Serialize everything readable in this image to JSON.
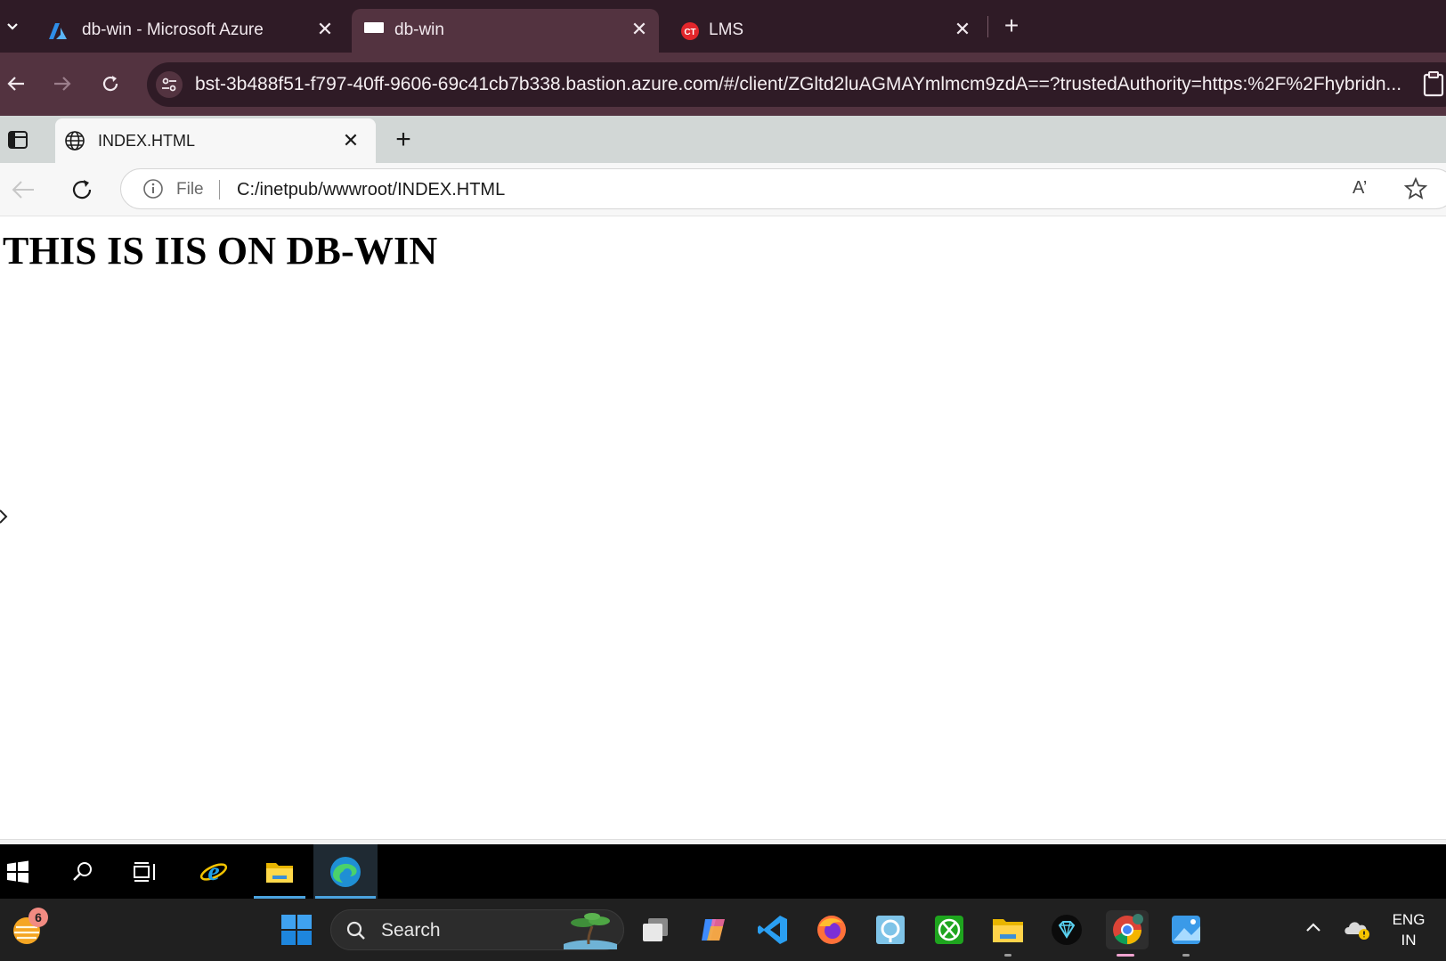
{
  "outer_browser": {
    "tabs": [
      {
        "title": "db-win - Microsoft Azure",
        "active": false
      },
      {
        "title": "db-win",
        "active": true
      },
      {
        "title": "LMS",
        "active": false
      }
    ],
    "url": "bst-3b488f51-f797-40ff-9606-69c41cb7b338.bastion.azure.com/#/client/ZGltd2luAGMAYmlmcm9zdA==?trustedAuthority=https:%2F%2Fhybridn..."
  },
  "inner_browser": {
    "tab_title": "INDEX.HTML",
    "address_scheme_label": "File",
    "address_path": "C:/inetpub/wwwroot/INDEX.HTML",
    "read_aloud_label": "A’"
  },
  "page": {
    "heading": "THIS IS IIS ON DB-WIN"
  },
  "remote_taskbar": {
    "items": [
      "start-icon",
      "search-icon",
      "task-view-icon",
      "internet-explorer-icon",
      "file-explorer-icon",
      "edge-icon"
    ],
    "active": "edge-icon"
  },
  "host_taskbar": {
    "weather_badge": "6",
    "search_label": "Search",
    "apps": [
      "start-icon",
      "task-view-icon",
      "copilot-icon",
      "vscode-icon",
      "firefox-icon",
      "remote-app-icon",
      "xbox-icon",
      "file-explorer-icon",
      "diamond-app-icon",
      "chrome-icon",
      "photos-icon"
    ],
    "language_line1": "ENG",
    "language_line2": "IN"
  },
  "colors": {
    "outer_tabbar": "#2f1b26",
    "outer_toolbar": "#533340",
    "inner_tabbar": "#d2d7d6",
    "remote_taskbar": "#000000",
    "host_taskbar": "#202020"
  }
}
